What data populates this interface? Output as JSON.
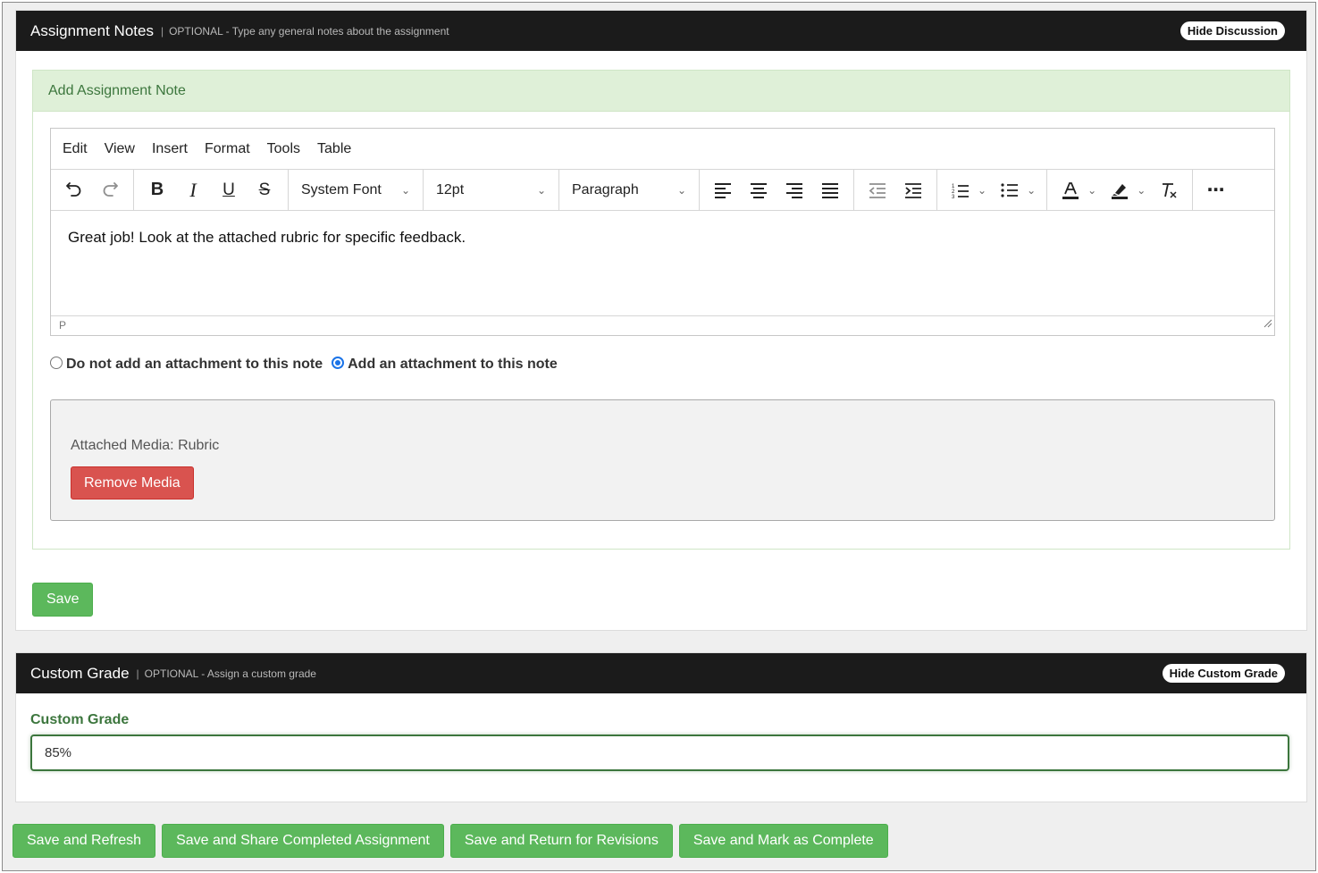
{
  "notes_panel": {
    "title": "Assignment Notes",
    "separator": "|",
    "hint": "OPTIONAL - Type any general notes about the assignment",
    "toggle_label": "Hide Discussion",
    "subheader": "Add Assignment Note"
  },
  "editor": {
    "menu": [
      "Edit",
      "View",
      "Insert",
      "Format",
      "Tools",
      "Table"
    ],
    "font_family": "System Font",
    "font_size": "12pt",
    "block_format": "Paragraph",
    "content": "Great job! Look at the attached rubric for specific feedback.",
    "status_path": "P"
  },
  "attachment": {
    "option_none": "Do not add an attachment to this note",
    "option_add": "Add an attachment to this note",
    "selected": "add",
    "media_label": "Attached Media: Rubric",
    "remove_label": "Remove Media"
  },
  "save_label": "Save",
  "grade_panel": {
    "title": "Custom Grade",
    "separator": "|",
    "hint": "OPTIONAL - Assign a custom grade",
    "toggle_label": "Hide Custom Grade",
    "field_label": "Custom Grade",
    "value": "85%"
  },
  "actions": [
    "Save and Refresh",
    "Save and Share Completed Assignment",
    "Save and Return for Revisions",
    "Save and Mark as Complete"
  ],
  "colors": {
    "header_bg": "#1b1b1b",
    "success_bg": "#dff0d8",
    "success_text": "#3c763d",
    "green_button": "#5cb85c",
    "red_button": "#d9534f",
    "radio_accent": "#1a73e8"
  }
}
